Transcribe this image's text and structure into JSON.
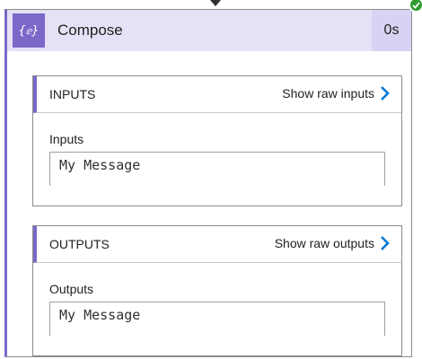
{
  "action": {
    "title": "Compose",
    "duration": "0s",
    "icon": "compose-icon",
    "status": "succeeded",
    "colors": {
      "accent": "#7b68c9",
      "header_bg": "#e6e1f6",
      "duration_bg": "#d9d2f2",
      "success": "#2f9b2f"
    }
  },
  "inputs": {
    "section_title": "INPUTS",
    "show_raw_label": "Show raw inputs",
    "field_label": "Inputs",
    "field_value": "My Message"
  },
  "outputs": {
    "section_title": "OUTPUTS",
    "show_raw_label": "Show raw outputs",
    "field_label": "Outputs",
    "field_value": "My Message"
  }
}
